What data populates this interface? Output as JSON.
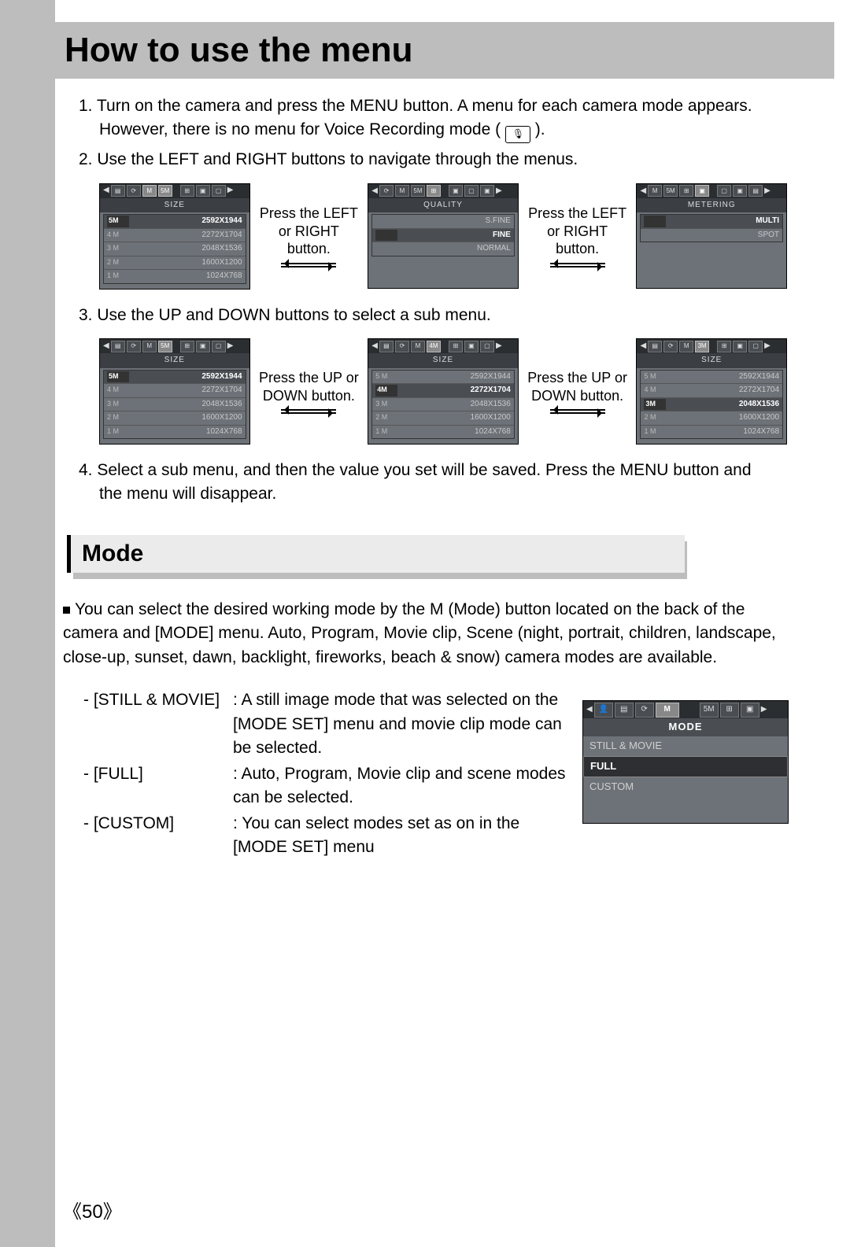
{
  "title": "How to use the menu",
  "steps": {
    "s1a": "1. Turn on the camera and press the MENU button. A menu for each camera mode appears.",
    "s1b": "However, there is no menu for Voice Recording mode (",
    "s1c": ").",
    "s2": "2. Use the LEFT and RIGHT buttons to navigate through the menus.",
    "s3": "3. Use the UP and DOWN buttons to select a sub menu.",
    "s4a": "4. Select a sub menu, and then the value you set will be saved. Press the MENU button and",
    "s4b": "the menu will disappear."
  },
  "between": {
    "lr1": "Press the LEFT",
    "lr2": "or RIGHT button.",
    "ud1": "Press the UP or",
    "ud2": "DOWN button."
  },
  "cam1": {
    "title": "SIZE",
    "rows": [
      {
        "lbl": "5M",
        "val": "2592X1944",
        "sel": true
      },
      {
        "lbl": "4 M",
        "val": "2272X1704"
      },
      {
        "lbl": "3 M",
        "val": "2048X1536"
      },
      {
        "lbl": "2 M",
        "val": "1600X1200"
      },
      {
        "lbl": "1 M",
        "val": "1024X768"
      }
    ]
  },
  "cam2": {
    "title": "QUALITY",
    "rows": [
      {
        "lbl": "",
        "val": "S.FINE"
      },
      {
        "lbl": "",
        "val": "FINE",
        "sel": true
      },
      {
        "lbl": "",
        "val": "NORMAL"
      }
    ]
  },
  "cam3": {
    "title": "METERING",
    "rows": [
      {
        "lbl": "",
        "val": "MULTI",
        "sel": true
      },
      {
        "lbl": "",
        "val": "SPOT"
      }
    ]
  },
  "cam4": {
    "title": "SIZE",
    "selTab": "5M",
    "rows": [
      {
        "lbl": "5M",
        "val": "2592X1944",
        "sel": true
      },
      {
        "lbl": "4 M",
        "val": "2272X1704"
      },
      {
        "lbl": "3 M",
        "val": "2048X1536"
      },
      {
        "lbl": "2 M",
        "val": "1600X1200"
      },
      {
        "lbl": "1 M",
        "val": "1024X768"
      }
    ]
  },
  "cam5": {
    "title": "SIZE",
    "selTab": "4M",
    "rows": [
      {
        "lbl": "5 M",
        "val": "2592X1944"
      },
      {
        "lbl": "4M",
        "val": "2272X1704",
        "sel": true
      },
      {
        "lbl": "3 M",
        "val": "2048X1536"
      },
      {
        "lbl": "2 M",
        "val": "1600X1200"
      },
      {
        "lbl": "1 M",
        "val": "1024X768"
      }
    ]
  },
  "cam6": {
    "title": "SIZE",
    "selTab": "3M",
    "rows": [
      {
        "lbl": "5 M",
        "val": "2592X1944"
      },
      {
        "lbl": "4 M",
        "val": "2272X1704"
      },
      {
        "lbl": "3M",
        "val": "2048X1536",
        "sel": true
      },
      {
        "lbl": "2 M",
        "val": "1600X1200"
      },
      {
        "lbl": "1 M",
        "val": "1024X768"
      }
    ]
  },
  "mode": {
    "heading": "Mode",
    "intro": "You can select the desired working mode by the M (Mode) button located on the back of the camera and [MODE] menu. Auto, Program, Movie clip, Scene (night, portrait, children, landscape, close-up, sunset, dawn, backlight, fireworks, beach & snow) camera modes are available.",
    "items": [
      {
        "k": "- [STILL & MOVIE]",
        "v": ": A still image mode that was selected on the [MODE SET] menu and movie clip mode can be selected."
      },
      {
        "k": "- [FULL]",
        "v": ": Auto, Program, Movie clip and scene modes can be selected."
      },
      {
        "k": "- [CUSTOM]",
        "v": ": You can select modes set as on in the [MODE SET] menu"
      }
    ],
    "screen": {
      "title": "MODE",
      "rows": [
        {
          "val": "STILL & MOVIE"
        },
        {
          "val": "FULL",
          "sel": true
        },
        {
          "val": "CUSTOM"
        }
      ]
    }
  },
  "pageNumber": "50",
  "icons": {
    "M": "M",
    "5m": "5M",
    "4m": "4M",
    "3m": "3M"
  }
}
